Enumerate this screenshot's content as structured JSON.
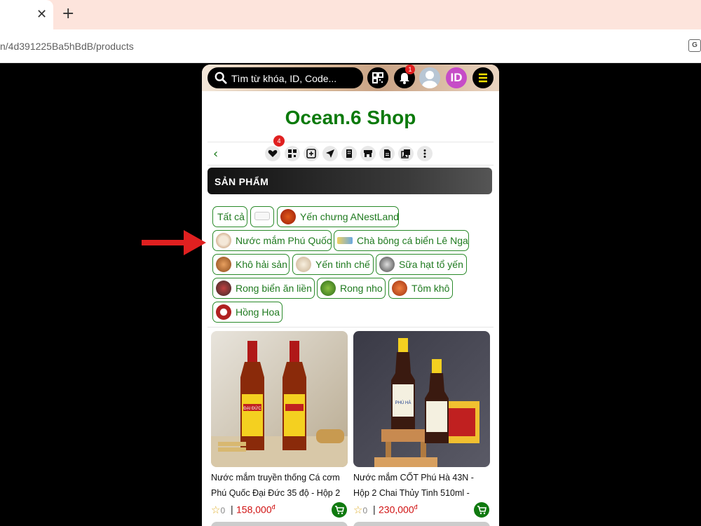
{
  "browser": {
    "tab_close": "✕",
    "new_tab": "+",
    "url": "n/4d391225Ba5hBdB/products",
    "translate": "G"
  },
  "topbar": {
    "search_placeholder": "Tìm từ khóa, ID, Code...",
    "notification_count": "1",
    "id_label": "ID"
  },
  "shop": {
    "title": "Ocean.6 Shop"
  },
  "actions": {
    "back": "‹",
    "favorites_count": "4"
  },
  "section": {
    "title": "SẢN PHẨM"
  },
  "categories": [
    {
      "label": "Tất cả"
    },
    {
      "label": ""
    },
    {
      "label": "Yến chưng ANestLand"
    },
    {
      "label": "Nước mắm Phú Quốc"
    },
    {
      "label": "Chà bông cá biển Lê Nga"
    },
    {
      "label": "Khô hải sản"
    },
    {
      "label": "Yến tinh chế"
    },
    {
      "label": "Sữa hạt tổ yến"
    },
    {
      "label": "Rong biển ăn liền"
    },
    {
      "label": "Rong nho"
    },
    {
      "label": "Tôm khô"
    },
    {
      "label": "Hồng Hoa"
    }
  ],
  "products": [
    {
      "name": "Nước mắm truyền thống Cá cơm Phú Quốc Đại Đức 35 độ - Hộp 2",
      "rating": "0",
      "price": "158,000",
      "currency": "đ",
      "bottle_label": "ĐẠI ĐỨC"
    },
    {
      "name": "Nước mắm CỐT Phú Hà 43N - Hộp 2 Chai Thủy Tinh 510ml -",
      "rating": "0",
      "price": "230,000",
      "currency": "đ",
      "bottle_label": "PHÚ HÀ"
    }
  ],
  "colors": {
    "accent_green": "#0c7a0c",
    "price_red": "#d01010",
    "badge_red": "#e02020"
  }
}
